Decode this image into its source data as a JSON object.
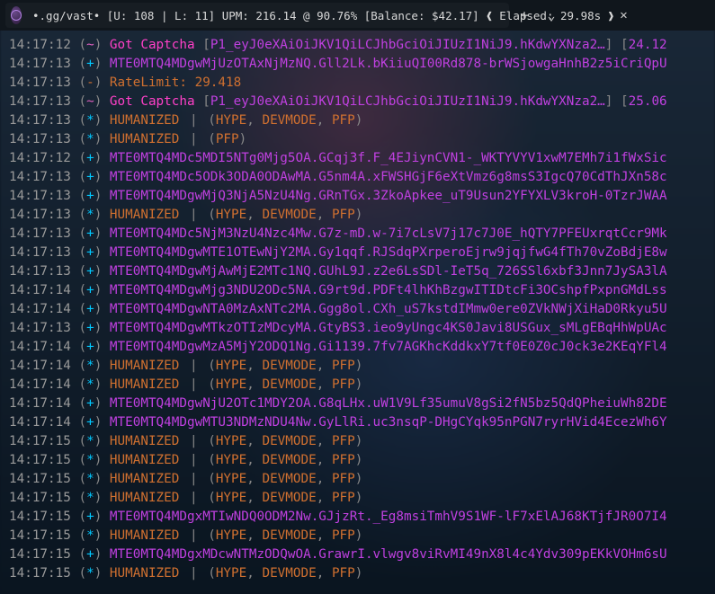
{
  "titlebar": {
    "tab_text": "•.gg/vast•  [U: 108 | L: 11]   UPM: 216.14 @ 90.76%   [Balance: $42.17]   ❰ Elapsed: 29.98s ❱",
    "close_glyph": "✕",
    "newtab_glyph": "+",
    "dropdown_glyph": "⌄"
  },
  "symbols": {
    "tilde": "~",
    "plus": "+",
    "minus": "-",
    "star": "*"
  },
  "log": [
    {
      "ts": "14:17:12",
      "sym": "tilde",
      "type": "captcha",
      "p1": "P1_eyJ0eXAiOiJKV1QiLCJhbGciOiJIUzI1NiJ9.hKdwYXNza2…",
      "num": "24.12"
    },
    {
      "ts": "14:17:13",
      "sym": "plus",
      "type": "token",
      "text": "MTE0MTQ4MDgwMjUzOTAxNjMzNQ.Gll2Lk.bKiiuQI00Rd878-brWSjowgaHnhB2z5iCriQpU"
    },
    {
      "ts": "14:17:13",
      "sym": "minus",
      "type": "ratelimit",
      "text": "RateLimit: 29.418"
    },
    {
      "ts": "14:17:13",
      "sym": "tilde",
      "type": "captcha",
      "p1": "P1_eyJ0eXAiOiJKV1QiLCJhbGciOiJIUzI1NiJ9.hKdwYXNza2…",
      "num": "25.06"
    },
    {
      "ts": "14:17:13",
      "sym": "star",
      "type": "humanized",
      "tags": [
        "HYPE",
        "DEVMODE",
        "PFP"
      ]
    },
    {
      "ts": "14:17:13",
      "sym": "star",
      "type": "humanized-pfp"
    },
    {
      "ts": "14:17:12",
      "sym": "plus",
      "type": "token",
      "text": "MTE0MTQ4MDc5MDI5NTg0Mjg5OA.GCqj3f.F_4EJiynCVN1-_WKTYVYV1xwM7EMh7i1fWxSic"
    },
    {
      "ts": "14:17:13",
      "sym": "plus",
      "type": "token",
      "text": "MTE0MTQ4MDc5ODk3ODA0ODAwMA.G5nm4A.xFWSHGjF6eXtVmz6g8msS3IgcQ70CdThJXn58c"
    },
    {
      "ts": "14:17:13",
      "sym": "plus",
      "type": "token",
      "text": "MTE0MTQ4MDgwMjQ3NjA5NzU4Ng.GRnTGx.3ZkoApkee_uT9Usun2YFYXLV3kroH-0TzrJWAA"
    },
    {
      "ts": "14:17:13",
      "sym": "star",
      "type": "humanized",
      "tags": [
        "HYPE",
        "DEVMODE",
        "PFP"
      ]
    },
    {
      "ts": "14:17:13",
      "sym": "plus",
      "type": "token",
      "text": "MTE0MTQ4MDc5NjM3NzU4Nzc4Mw.G7z-mD.w-7i7cLsV7j17c7J0E_hQTY7PFEUxrqtCcr9Mk"
    },
    {
      "ts": "14:17:13",
      "sym": "plus",
      "type": "token",
      "text": "MTE0MTQ4MDgwMTE1OTEwNjY2MA.Gy1qqf.RJSdqPXrperoEjrw9jqjfwG4fTh70vZoBdjE8w"
    },
    {
      "ts": "14:17:13",
      "sym": "plus",
      "type": "token",
      "text": "MTE0MTQ4MDgwMjAwMjE2MTc1NQ.GUhL9J.z2e6LsSDl-IeT5q_726SSl6xbf3Jnn7JySA3lA"
    },
    {
      "ts": "14:17:14",
      "sym": "plus",
      "type": "token",
      "text": "MTE0MTQ4MDgwMjg3NDU2ODc5NA.G9rt9d.PDFt4lhKhBzgwITIDtcFi3OCshpfPxpnGMdLss"
    },
    {
      "ts": "14:17:14",
      "sym": "plus",
      "type": "token",
      "text": "MTE0MTQ4MDgwNTA0MzAxNTc2MA.Ggg8ol.CXh_uS7kstdIMmw0ere0ZVkNWjXiHaD0Rkyu5U"
    },
    {
      "ts": "14:17:13",
      "sym": "plus",
      "type": "token",
      "text": "MTE0MTQ4MDgwMTkzOTIzMDcyMA.GtyBS3.ieo9yUngc4KS0Javi8USGux_sMLgEBqHhWpUAc"
    },
    {
      "ts": "14:17:14",
      "sym": "plus",
      "type": "token",
      "text": "MTE0MTQ4MDgwMzA5MjY2ODQ1Ng.Gi1139.7fv7AGKhcKddkxY7tf0E0Z0cJ0ck3e2KEqYFl4"
    },
    {
      "ts": "14:17:14",
      "sym": "star",
      "type": "humanized",
      "tags": [
        "HYPE",
        "DEVMODE",
        "PFP"
      ]
    },
    {
      "ts": "14:17:14",
      "sym": "star",
      "type": "humanized",
      "tags": [
        "HYPE",
        "DEVMODE",
        "PFP"
      ]
    },
    {
      "ts": "14:17:14",
      "sym": "plus",
      "type": "token",
      "text": "MTE0MTQ4MDgwNjU2OTc1MDY2OA.G8qLHx.uW1V9Lf35umuV8gSi2fN5bz5QdQPheiuWh82DE"
    },
    {
      "ts": "14:17:14",
      "sym": "plus",
      "type": "token",
      "text": "MTE0MTQ4MDgwMTU3NDMzNDU4Nw.GyLlRi.uc3nsqP-DHgCYqk95nPGN7ryrHVid4EcezWh6Y"
    },
    {
      "ts": "14:17:15",
      "sym": "star",
      "type": "humanized",
      "tags": [
        "HYPE",
        "DEVMODE",
        "PFP"
      ]
    },
    {
      "ts": "14:17:15",
      "sym": "star",
      "type": "humanized",
      "tags": [
        "HYPE",
        "DEVMODE",
        "PFP"
      ]
    },
    {
      "ts": "14:17:15",
      "sym": "star",
      "type": "humanized",
      "tags": [
        "HYPE",
        "DEVMODE",
        "PFP"
      ]
    },
    {
      "ts": "14:17:15",
      "sym": "star",
      "type": "humanized",
      "tags": [
        "HYPE",
        "DEVMODE",
        "PFP"
      ]
    },
    {
      "ts": "14:17:15",
      "sym": "plus",
      "type": "token",
      "text": "MTE0MTQ4MDgxMTIwNDQ0ODM2Nw.GJjzRt._Eg8msiTmhV9S1WF-lF7xElAJ68KTjfJR0O7I4"
    },
    {
      "ts": "14:17:15",
      "sym": "star",
      "type": "humanized",
      "tags": [
        "HYPE",
        "DEVMODE",
        "PFP"
      ]
    },
    {
      "ts": "14:17:15",
      "sym": "plus",
      "type": "token",
      "text": "MTE0MTQ4MDgxMDcwNTMzODQwOA.GrawrI.vlwgv8viRvMI49nX8l4c4Ydv309pEKkVOHm6sU"
    },
    {
      "ts": "14:17:15",
      "sym": "star",
      "type": "humanized",
      "tags": [
        "HYPE",
        "DEVMODE",
        "PFP"
      ]
    }
  ]
}
